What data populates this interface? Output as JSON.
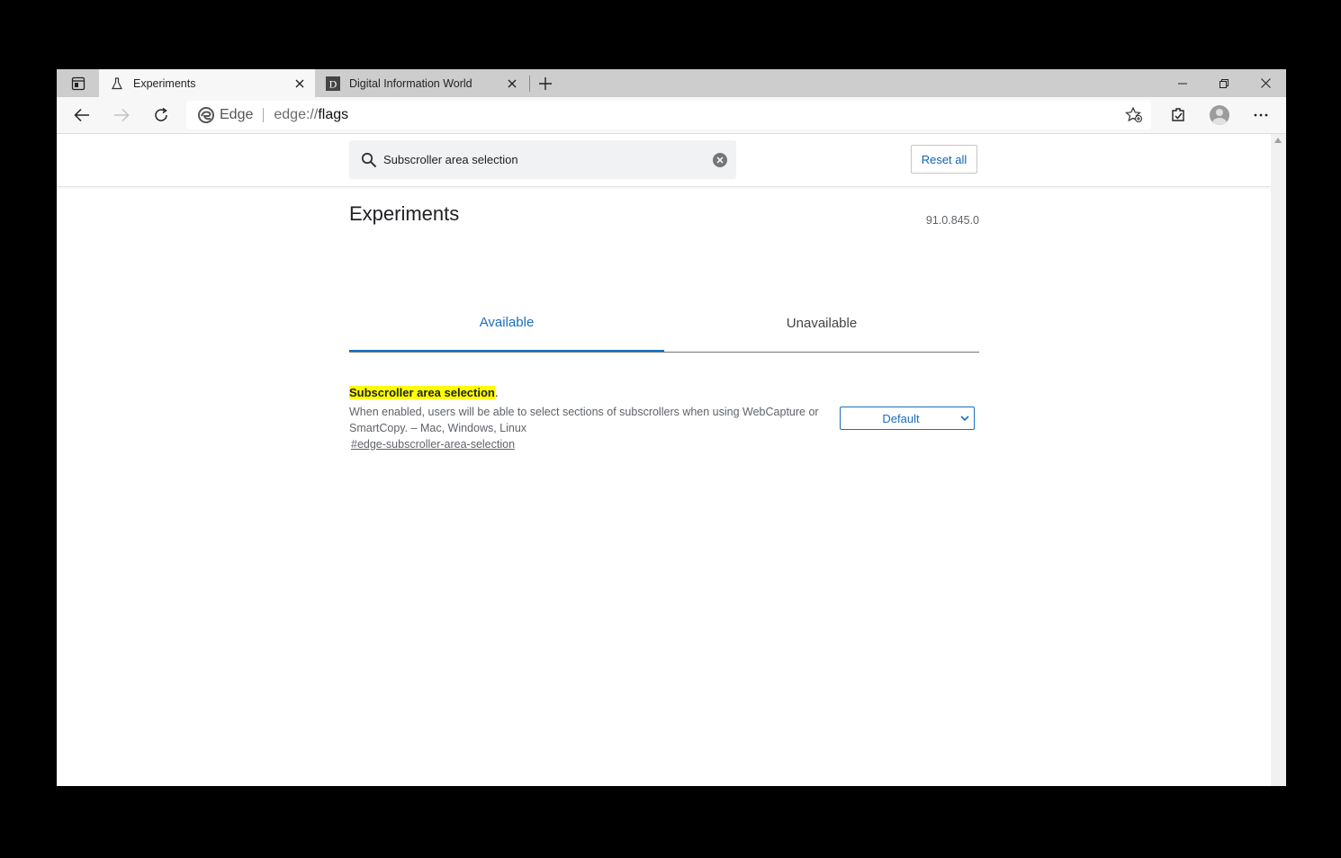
{
  "browser": {
    "tabs": [
      {
        "title": "Experiments",
        "active": true,
        "favicon": "flask-icon"
      },
      {
        "title": "Digital Information World",
        "active": false,
        "favicon": "D"
      }
    ],
    "address": {
      "brand": "Edge",
      "scheme": "edge://",
      "path": "flags"
    }
  },
  "search": {
    "value": "Subscroller area selection"
  },
  "reset_label": "Reset all",
  "page": {
    "title": "Experiments",
    "version": "91.0.845.0",
    "tabs": [
      "Available",
      "Unavailable"
    ],
    "active_tab": "Available"
  },
  "flag": {
    "name": "Subscroller area selection",
    "name_suffix": ".",
    "description": "When enabled, users will be able to select sections of subscrollers when using WebCapture or SmartCopy. – Mac, Windows, Linux",
    "link": "#edge-subscroller-area-selection",
    "selected_option": "Default"
  },
  "colors": {
    "accent": "#1a6ec1",
    "highlight": "#ffff00",
    "tabstrip": "#cdcdcd"
  }
}
